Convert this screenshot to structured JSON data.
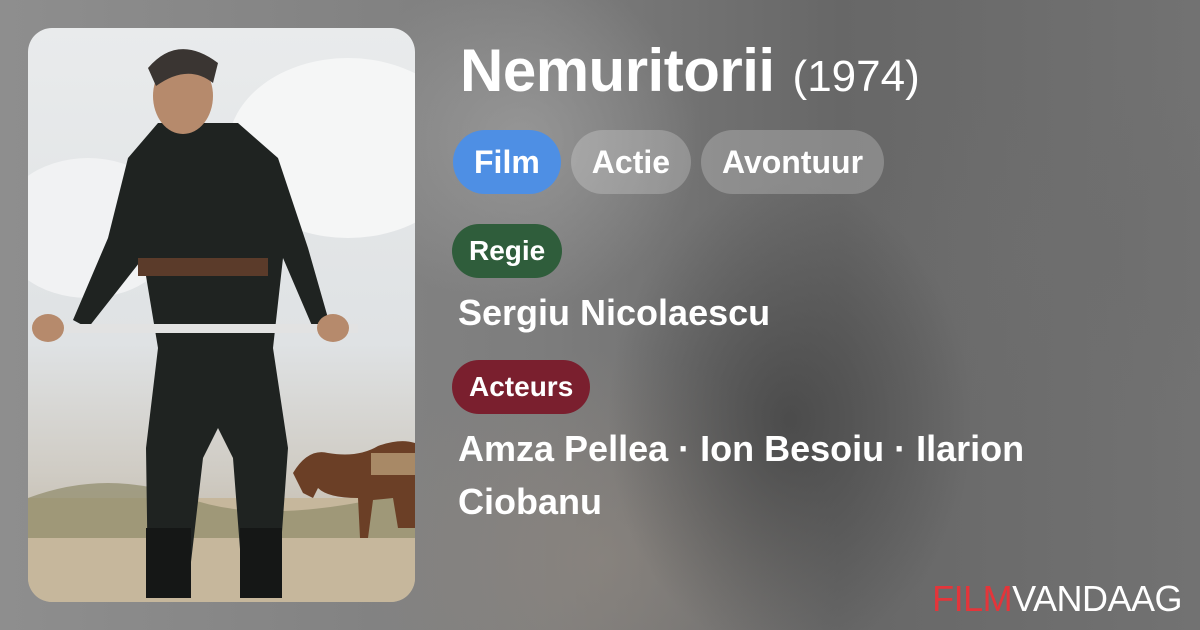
{
  "movie": {
    "title": "Nemuritorii",
    "year": "(1974)"
  },
  "genres": [
    "Film",
    "Actie",
    "Avontuur"
  ],
  "credits": {
    "director_label": "Regie",
    "director": "Sergiu Nicolaescu",
    "cast_label": "Acteurs",
    "cast": "Amza Pellea · Ion Besoiu · Ilarion Ciobanu"
  },
  "brand": {
    "part1": "FILM",
    "part2": "VANDAAG"
  },
  "colors": {
    "active_chip": "#4e8fe4",
    "director_label": "#2f5d3b",
    "cast_label": "#7a1f2e",
    "brand_accent": "#e4353a"
  }
}
